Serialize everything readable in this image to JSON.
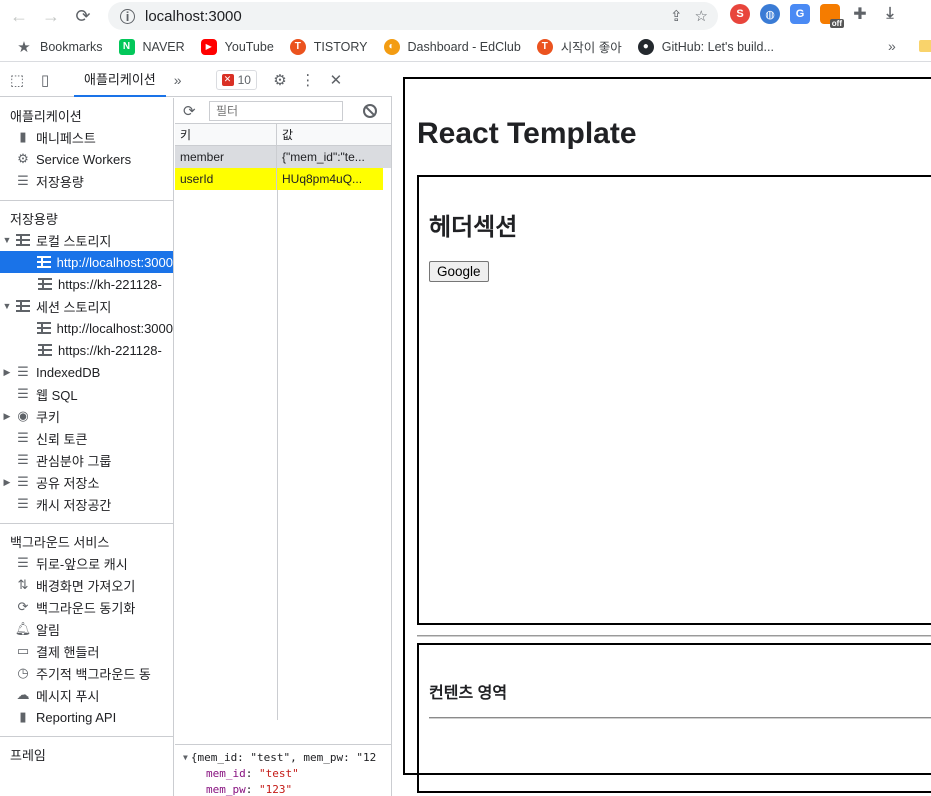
{
  "browser": {
    "url": "localhost:3000",
    "bookmarks": [
      {
        "label": "Bookmarks",
        "icon": "star-icon"
      },
      {
        "label": "NAVER",
        "icon": "naver-icon"
      },
      {
        "label": "YouTube",
        "icon": "youtube-icon"
      },
      {
        "label": "TISTORY",
        "icon": "tistory-icon"
      },
      {
        "label": "Dashboard - EdClub",
        "icon": "edclub-icon"
      },
      {
        "label": "시작이 좋아",
        "icon": "tistory-icon"
      },
      {
        "label": "GitHub: Let's build...",
        "icon": "github-icon"
      }
    ],
    "bookmarks_more": "»",
    "ext_off_label": "off"
  },
  "devtools": {
    "active_tab": "애플리케이션",
    "more_tabs": "»",
    "error_count": "10",
    "sidebar": {
      "app_section": "애플리케이션",
      "app_items": [
        "매니페스트",
        "Service Workers",
        "저장용량"
      ],
      "storage_section": "저장용량",
      "local_storage": "로컬 스토리지",
      "local_items": [
        "http://localhost:3000",
        "https://kh-221128-"
      ],
      "session_storage": "세션 스토리지",
      "session_items": [
        "http://localhost:3000",
        "https://kh-221128-"
      ],
      "other_storage": [
        "IndexedDB",
        "웹 SQL",
        "쿠키",
        "신뢰 토큰",
        "관심분야 그룹",
        "공유 저장소",
        "캐시 저장공간"
      ],
      "bg_section": "백그라운드 서비스",
      "bg_items": [
        "뒤로-앞으로 캐시",
        "배경화면 가져오기",
        "백그라운드 동기화",
        "알림",
        "결제 핸들러",
        "주기적 백그라운드 동",
        "메시지 푸시",
        "Reporting API"
      ],
      "frame_section": "프레임"
    },
    "storage": {
      "filter_placeholder": "필터",
      "col_key": "키",
      "col_value": "값",
      "rows": [
        {
          "key": "member",
          "value": "{\"mem_id\":\"te..."
        },
        {
          "key": "userId",
          "value": "HUq8pm4uQ..."
        }
      ],
      "preview_line": "{mem_id: \"test\", mem_pw: \"12",
      "preview_props": [
        {
          "key": "mem_id",
          "value": "\"test\""
        },
        {
          "key": "mem_pw",
          "value": "\"123\""
        }
      ]
    }
  },
  "page": {
    "title": "React Template",
    "header_title": "헤더섹션",
    "google_button": "Google",
    "content_title": "컨텐츠 영역"
  }
}
